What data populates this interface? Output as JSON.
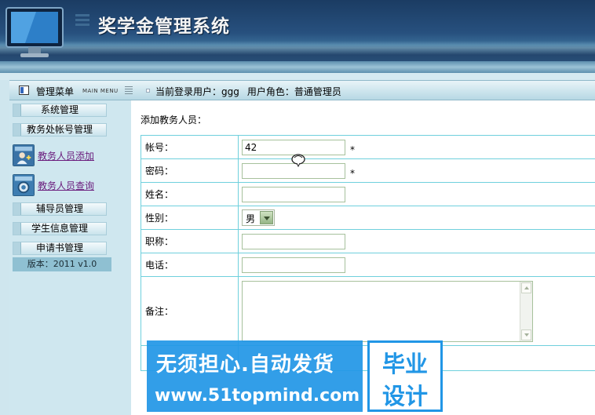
{
  "header": {
    "title": "奖学金管理系统"
  },
  "toolbar": {
    "menu_title": "管理菜单",
    "menu_subtitle": "MAIN MENU",
    "current_user_label": "当前登录用户：ggg",
    "role_label": "用户角色：普通管理员"
  },
  "sidebar": {
    "items": [
      {
        "label": "系统管理"
      },
      {
        "label": "教务处帐号管理"
      },
      {
        "label": "教务人员添加",
        "icon": "user-add-icon"
      },
      {
        "label": "教务人员查询",
        "icon": "gear-search-icon"
      },
      {
        "label": "辅导员管理"
      },
      {
        "label": "学生信息管理"
      },
      {
        "label": "申请书管理"
      }
    ],
    "version": "版本：2011 v1.0"
  },
  "form": {
    "section_title": "添加教务人员：",
    "required_mark": "*",
    "fields": {
      "account": {
        "label": "帐号：",
        "value": "42"
      },
      "password": {
        "label": "密码：",
        "value": ""
      },
      "name": {
        "label": "姓名：",
        "value": ""
      },
      "gender": {
        "label": "性别：",
        "value": "男"
      },
      "title": {
        "label": "职称：",
        "value": ""
      },
      "phone": {
        "label": "电话：",
        "value": ""
      },
      "notes": {
        "label": "备注：",
        "value": ""
      }
    }
  },
  "watermark": {
    "slogan": "无须担心.自动发货",
    "url": "www.51topmind.com",
    "badge_line1": "毕业",
    "badge_line2": "设计"
  }
}
